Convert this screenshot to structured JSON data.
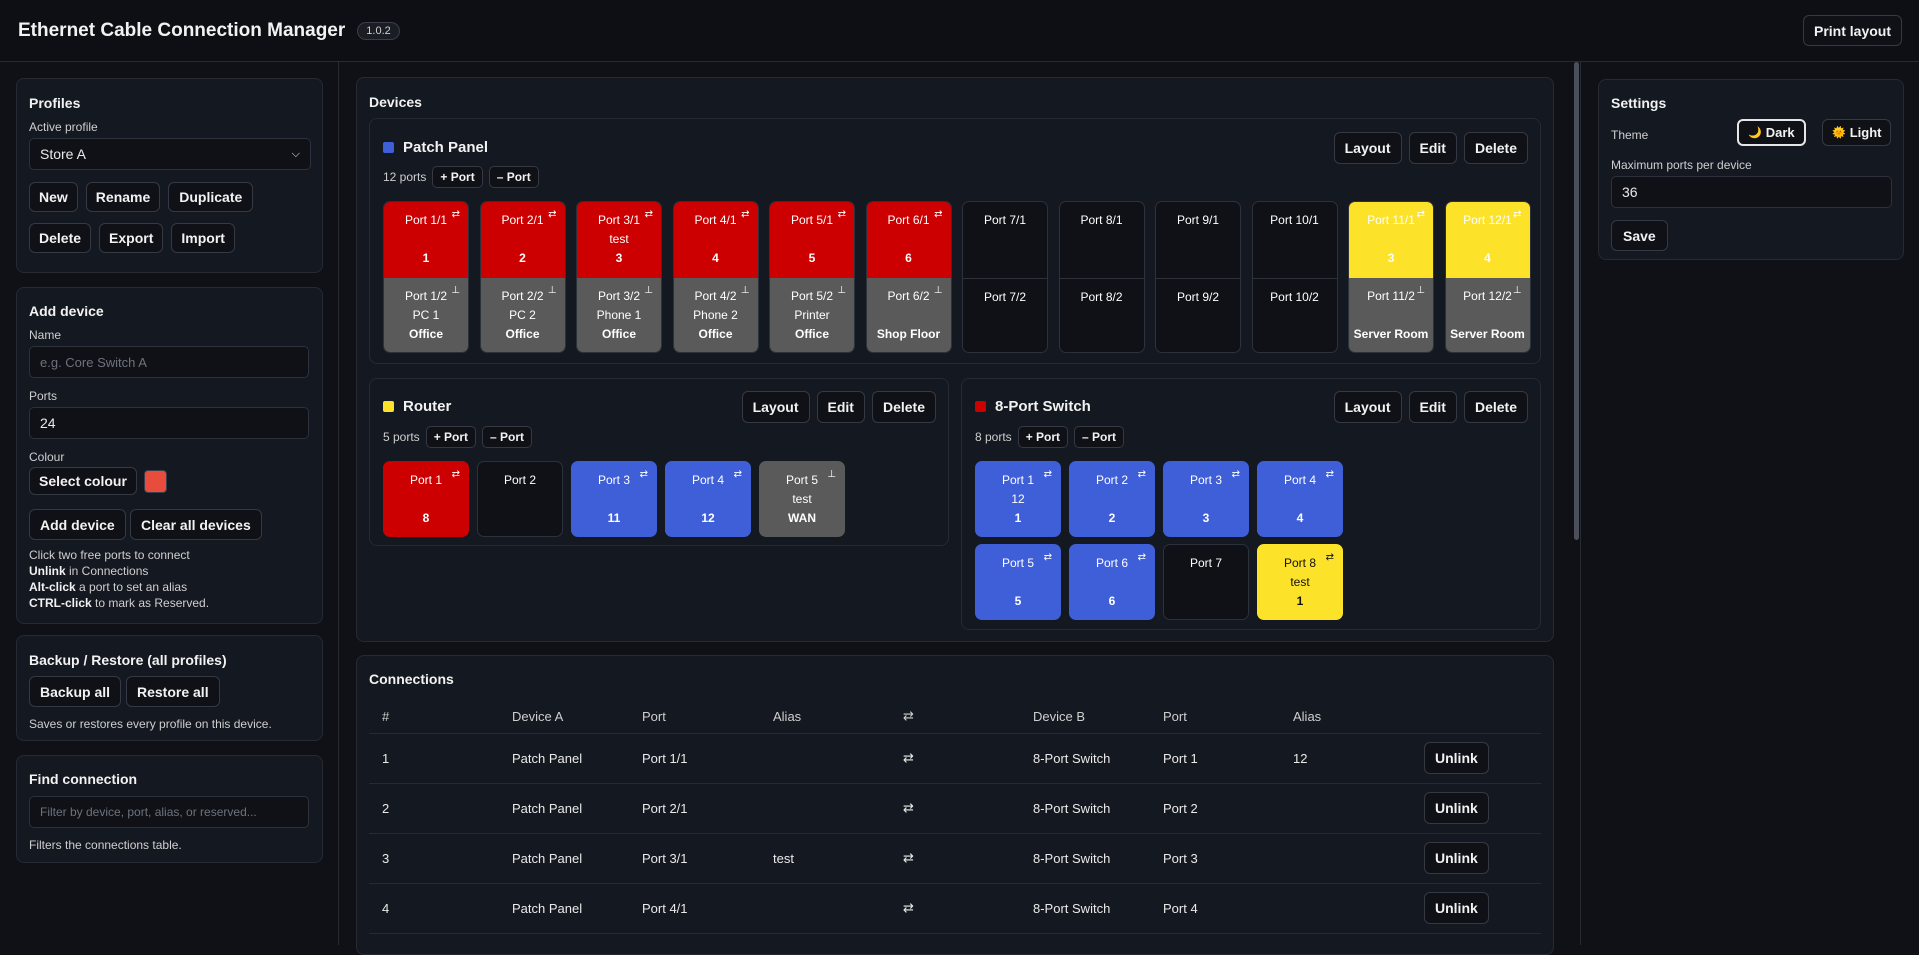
{
  "app": {
    "title": "Ethernet Cable Connection Manager",
    "version": "1.0.2",
    "print_label": "Print layout"
  },
  "profiles": {
    "heading": "Profiles",
    "active_label": "Active profile",
    "active_value": "Store A",
    "buttons": {
      "new": "New",
      "rename": "Rename",
      "duplicate": "Duplicate",
      "delete": "Delete",
      "export": "Export",
      "import": "Import"
    }
  },
  "add_device": {
    "heading": "Add device",
    "name_label": "Name",
    "name_placeholder": "e.g. Core Switch A",
    "ports_label": "Ports",
    "ports_value": "24",
    "colour_label": "Colour",
    "select_colour": "Select colour",
    "colour_value": "#e74c3c",
    "add_button": "Add device",
    "clear_button": "Clear all devices",
    "help": [
      {
        "pre": "",
        "bold": "",
        "post": "Click two free ports to connect"
      },
      {
        "pre": "",
        "bold": "Unlink",
        "post": " in Connections"
      },
      {
        "pre": "",
        "bold": "Alt-click",
        "post": " a port to set an alias"
      },
      {
        "pre": "",
        "bold": "CTRL-click",
        "post": " to mark as Reserved."
      }
    ]
  },
  "backup": {
    "heading": "Backup / Restore (all profiles)",
    "backup_all": "Backup all",
    "restore_all": "Restore all",
    "note": "Saves or restores every profile on this device."
  },
  "find": {
    "heading": "Find connection",
    "placeholder": "Filter by device, port, alias, or reserved...",
    "note": "Filters the connections table."
  },
  "devices_heading": "Devices",
  "device_actions": {
    "layout": "Layout",
    "edit": "Edit",
    "delete": "Delete",
    "add_port": "+ Port",
    "remove_port": "– Port"
  },
  "icons": {
    "linked": "⇄",
    "reserved": "⊥"
  },
  "patch_panel": {
    "name": "Patch Panel",
    "color": "#3f5fd8",
    "ports_count": "12 ports",
    "columns": [
      {
        "top": {
          "label": "Port 1/1",
          "alias": "",
          "num": "1",
          "state": "red"
        },
        "bot": {
          "label": "Port 1/2",
          "alias": "PC 1",
          "num": "Office",
          "state": "grey"
        }
      },
      {
        "top": {
          "label": "Port 2/1",
          "alias": "",
          "num": "2",
          "state": "red"
        },
        "bot": {
          "label": "Port 2/2",
          "alias": "PC 2",
          "num": "Office",
          "state": "grey"
        }
      },
      {
        "top": {
          "label": "Port 3/1",
          "alias": "test",
          "num": "3",
          "state": "red"
        },
        "bot": {
          "label": "Port 3/2",
          "alias": "Phone 1",
          "num": "Office",
          "state": "grey"
        }
      },
      {
        "top": {
          "label": "Port 4/1",
          "alias": "",
          "num": "4",
          "state": "red"
        },
        "bot": {
          "label": "Port 4/2",
          "alias": "Phone 2",
          "num": "Office",
          "state": "grey"
        }
      },
      {
        "top": {
          "label": "Port 5/1",
          "alias": "",
          "num": "5",
          "state": "red"
        },
        "bot": {
          "label": "Port 5/2",
          "alias": "Printer",
          "num": "Office",
          "state": "grey"
        }
      },
      {
        "top": {
          "label": "Port 6/1",
          "alias": "",
          "num": "6",
          "state": "red"
        },
        "bot": {
          "label": "Port 6/2",
          "alias": "",
          "num": "Shop Floor",
          "state": "grey"
        }
      },
      {
        "top": {
          "label": "Port 7/1",
          "alias": "",
          "num": "",
          "state": "free"
        },
        "bot": {
          "label": "Port 7/2",
          "alias": "",
          "num": "",
          "state": "free"
        }
      },
      {
        "top": {
          "label": "Port 8/1",
          "alias": "",
          "num": "",
          "state": "free"
        },
        "bot": {
          "label": "Port 8/2",
          "alias": "",
          "num": "",
          "state": "free"
        }
      },
      {
        "top": {
          "label": "Port 9/1",
          "alias": "",
          "num": "",
          "state": "free"
        },
        "bot": {
          "label": "Port 9/2",
          "alias": "",
          "num": "",
          "state": "free"
        }
      },
      {
        "top": {
          "label": "Port 10/1",
          "alias": "",
          "num": "",
          "state": "free"
        },
        "bot": {
          "label": "Port 10/2",
          "alias": "",
          "num": "",
          "state": "free"
        }
      },
      {
        "top": {
          "label": "Port 11/1",
          "alias": "",
          "num": "3",
          "state": "yellow"
        },
        "bot": {
          "label": "Port 11/2",
          "alias": "",
          "num": "Server Room",
          "state": "grey"
        }
      },
      {
        "top": {
          "label": "Port 12/1",
          "alias": "",
          "num": "4",
          "state": "yellow"
        },
        "bot": {
          "label": "Port 12/2",
          "alias": "",
          "num": "Server Room",
          "state": "grey"
        }
      }
    ]
  },
  "router": {
    "name": "Router",
    "color": "#fde22a",
    "ports_count": "5 ports",
    "ports": [
      {
        "label": "Port 1",
        "alias": "",
        "num": "8",
        "state": "red"
      },
      {
        "label": "Port 2",
        "alias": "",
        "num": "",
        "state": "free"
      },
      {
        "label": "Port 3",
        "alias": "",
        "num": "11",
        "state": "blue"
      },
      {
        "label": "Port 4",
        "alias": "",
        "num": "12",
        "state": "blue"
      },
      {
        "label": "Port 5",
        "alias": "test",
        "num": "WAN",
        "state": "grey"
      }
    ]
  },
  "switch8": {
    "name": "8-Port Switch",
    "color": "#cc0000",
    "ports_count": "8 ports",
    "ports": [
      {
        "label": "Port 1",
        "alias": "12",
        "num": "1",
        "state": "blue"
      },
      {
        "label": "Port 2",
        "alias": "",
        "num": "2",
        "state": "blue"
      },
      {
        "label": "Port 3",
        "alias": "",
        "num": "3",
        "state": "blue"
      },
      {
        "label": "Port 4",
        "alias": "",
        "num": "4",
        "state": "blue"
      },
      {
        "label": "Port 5",
        "alias": "",
        "num": "5",
        "state": "blue"
      },
      {
        "label": "Port 6",
        "alias": "",
        "num": "6",
        "state": "blue"
      },
      {
        "label": "Port 7",
        "alias": "",
        "num": "",
        "state": "free"
      },
      {
        "label": "Port 8",
        "alias": "test",
        "num": "1",
        "state": "yellow"
      }
    ]
  },
  "connections": {
    "heading": "Connections",
    "headers": [
      "#",
      "Device A",
      "Port",
      "Alias",
      "⇄",
      "Device B",
      "Port",
      "Alias",
      ""
    ],
    "unlink_label": "Unlink",
    "rows": [
      {
        "n": "1",
        "a": "Patch Panel",
        "pa": "Port 1/1",
        "aa": "",
        "b": "8-Port Switch",
        "pb": "Port 1",
        "ab": "12"
      },
      {
        "n": "2",
        "a": "Patch Panel",
        "pa": "Port 2/1",
        "aa": "",
        "b": "8-Port Switch",
        "pb": "Port 2",
        "ab": ""
      },
      {
        "n": "3",
        "a": "Patch Panel",
        "pa": "Port 3/1",
        "aa": "test",
        "b": "8-Port Switch",
        "pb": "Port 3",
        "ab": ""
      },
      {
        "n": "4",
        "a": "Patch Panel",
        "pa": "Port 4/1",
        "aa": "",
        "b": "8-Port Switch",
        "pb": "Port 4",
        "ab": ""
      }
    ]
  },
  "settings": {
    "heading": "Settings",
    "theme_label": "Theme",
    "dark": "Dark",
    "light": "Light",
    "dark_icon": "🌙",
    "light_icon": "🌞",
    "max_ports_label": "Maximum ports per device",
    "max_ports_value": "36",
    "save": "Save"
  }
}
